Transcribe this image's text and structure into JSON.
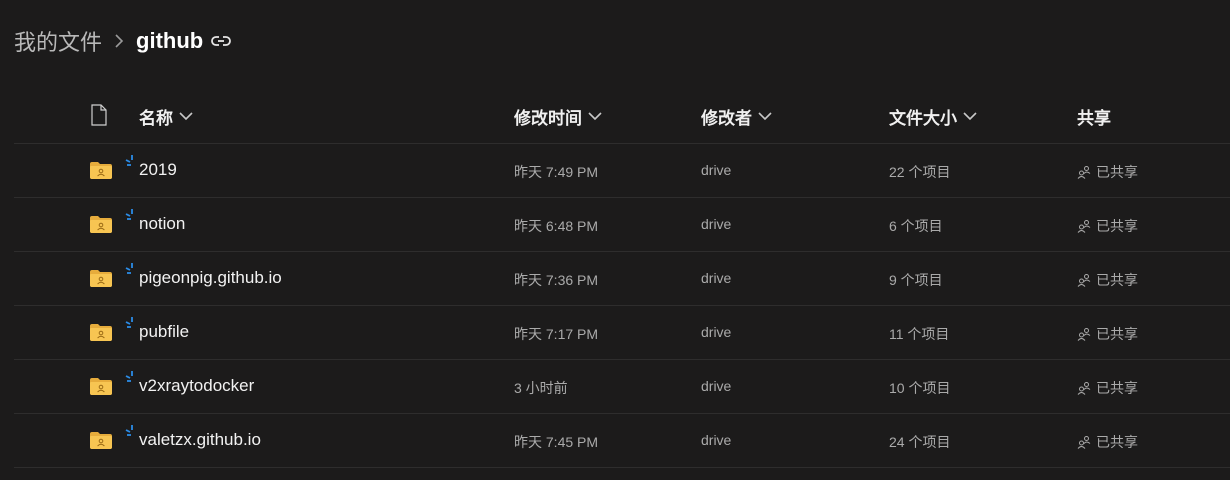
{
  "breadcrumb": {
    "root": "我的文件",
    "current": "github"
  },
  "columns": {
    "name": "名称",
    "modified": "修改时间",
    "modified_by": "修改者",
    "size": "文件大小",
    "sharing": "共享"
  },
  "rows": [
    {
      "name": "2019",
      "modified": "昨天 7:49 PM",
      "modified_by": "drive",
      "size": "22 个项目",
      "sharing": "已共享"
    },
    {
      "name": "notion",
      "modified": "昨天 6:48 PM",
      "modified_by": "drive",
      "size": "6 个项目",
      "sharing": "已共享"
    },
    {
      "name": "pigeonpig.github.io",
      "modified": "昨天 7:36 PM",
      "modified_by": "drive",
      "size": "9 个项目",
      "sharing": "已共享"
    },
    {
      "name": "pubfile",
      "modified": "昨天 7:17 PM",
      "modified_by": "drive",
      "size": "11 个项目",
      "sharing": "已共享"
    },
    {
      "name": "v2xraytodocker",
      "modified": "3 小时前",
      "modified_by": "drive",
      "size": "10 个项目",
      "sharing": "已共享"
    },
    {
      "name": "valetzx.github.io",
      "modified": "昨天 7:45 PM",
      "modified_by": "drive",
      "size": "24 个项目",
      "sharing": "已共享"
    }
  ],
  "icons": {
    "folder": "shared-folder-icon",
    "sync": "sync-spinner-icon",
    "share": "people-icon",
    "link": "link-icon",
    "file": "file-type-icon",
    "sort": "chevron-down-icon"
  },
  "colors": {
    "background": "#1c1b1b",
    "folder": "#f7c552",
    "sync_accent": "#2b8ce6"
  }
}
